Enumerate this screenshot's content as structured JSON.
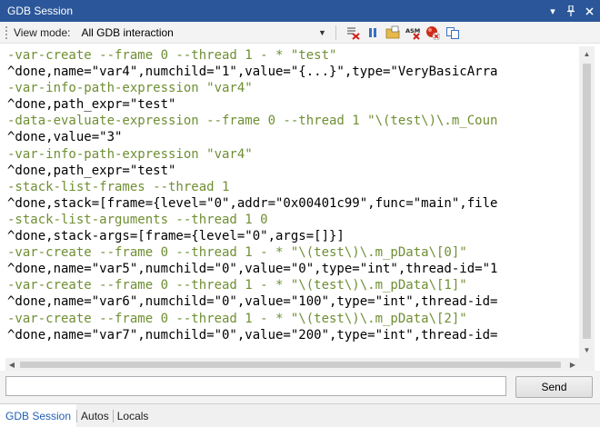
{
  "window": {
    "title": "GDB Session"
  },
  "toolbar": {
    "view_mode_label": "View mode:",
    "view_mode_value": "All GDB interaction",
    "icons": [
      "clear-icon",
      "pause-icon",
      "open-folder-icon",
      "disassembly-icon",
      "stop-record-icon",
      "copy-icon"
    ]
  },
  "console": {
    "lines": [
      {
        "type": "cmd",
        "text": "-var-create --frame 0 --thread 1 - * \"test\""
      },
      {
        "type": "resp",
        "text": "^done,name=\"var4\",numchild=\"1\",value=\"{...}\",type=\"VeryBasicArra"
      },
      {
        "type": "cmd",
        "text": "-var-info-path-expression \"var4\""
      },
      {
        "type": "resp",
        "text": "^done,path_expr=\"test\""
      },
      {
        "type": "cmd",
        "text": "-data-evaluate-expression --frame 0 --thread 1 \"\\(test\\)\\.m_Coun"
      },
      {
        "type": "resp",
        "text": "^done,value=\"3\""
      },
      {
        "type": "cmd",
        "text": "-var-info-path-expression \"var4\""
      },
      {
        "type": "resp",
        "text": "^done,path_expr=\"test\""
      },
      {
        "type": "cmd",
        "text": "-stack-list-frames --thread 1"
      },
      {
        "type": "resp",
        "text": "^done,stack=[frame={level=\"0\",addr=\"0x00401c99\",func=\"main\",file"
      },
      {
        "type": "cmd",
        "text": "-stack-list-arguments --thread 1 0"
      },
      {
        "type": "resp",
        "text": "^done,stack-args=[frame={level=\"0\",args=[]}]"
      },
      {
        "type": "cmd",
        "text": "-var-create --frame 0 --thread 1 - * \"\\(test\\)\\.m_pData\\[0]\""
      },
      {
        "type": "resp",
        "text": "^done,name=\"var5\",numchild=\"0\",value=\"0\",type=\"int\",thread-id=\"1"
      },
      {
        "type": "cmd",
        "text": "-var-create --frame 0 --thread 1 - * \"\\(test\\)\\.m_pData\\[1]\""
      },
      {
        "type": "resp",
        "text": "^done,name=\"var6\",numchild=\"0\",value=\"100\",type=\"int\",thread-id="
      },
      {
        "type": "cmd",
        "text": "-var-create --frame 0 --thread 1 - * \"\\(test\\)\\.m_pData\\[2]\""
      },
      {
        "type": "resp",
        "text": "^done,name=\"var7\",numchild=\"0\",value=\"200\",type=\"int\",thread-id="
      }
    ]
  },
  "input": {
    "value": "",
    "send_label": "Send"
  },
  "tabs": [
    {
      "label": "GDB Session",
      "active": true
    },
    {
      "label": "Autos",
      "active": false
    },
    {
      "label": "Locals",
      "active": false
    }
  ],
  "colors": {
    "titlebar": "#2b579a",
    "command_text": "#6f8f33",
    "response_text": "#000000",
    "active_tab_text": "#1e5fb4"
  }
}
